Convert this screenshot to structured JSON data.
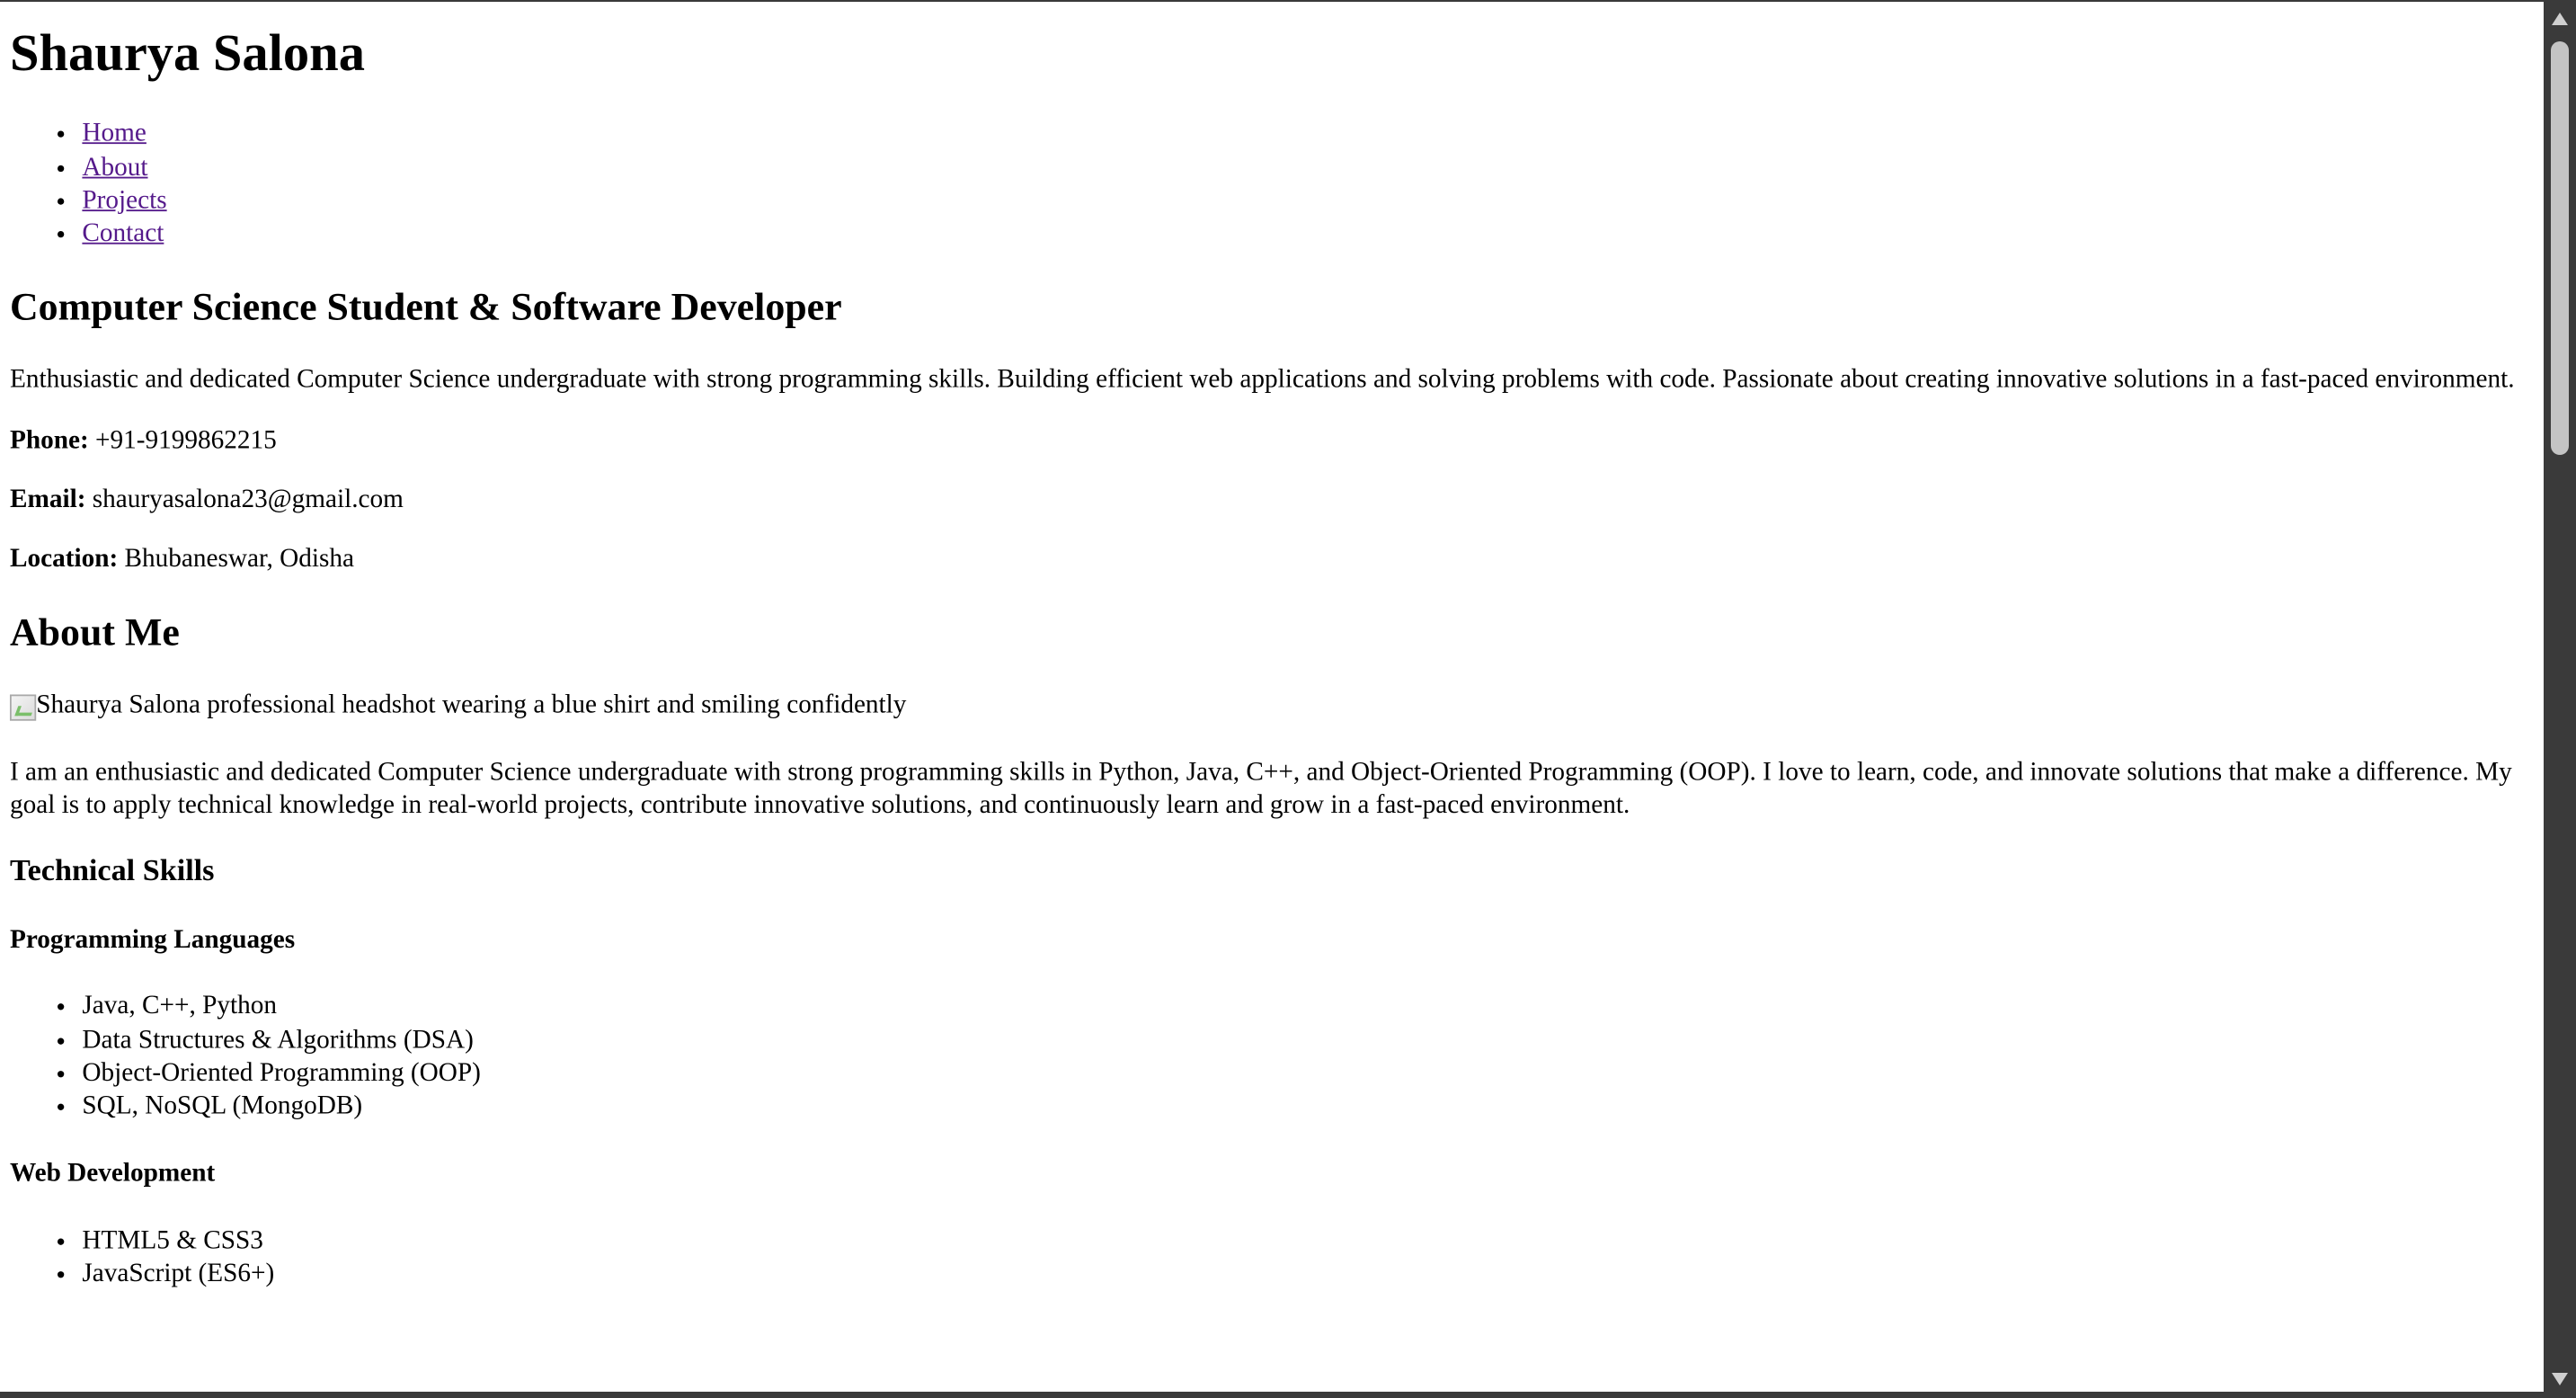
{
  "header": {
    "title": "Shaurya Salona"
  },
  "nav": {
    "items": [
      {
        "label": "Home"
      },
      {
        "label": "About"
      },
      {
        "label": "Projects"
      },
      {
        "label": "Contact"
      }
    ]
  },
  "hero": {
    "heading": "Computer Science Student & Software Developer",
    "intro": "Enthusiastic and dedicated Computer Science undergraduate with strong programming skills. Building efficient web applications and solving problems with code. Passionate about creating innovative solutions in a fast-paced environment.",
    "phone_label": "Phone:",
    "phone_value": " +91-9199862215",
    "email_label": "Email:",
    "email_value": " shauryasalona23@gmail.com",
    "location_label": "Location:",
    "location_value": " Bhubaneswar, Odisha"
  },
  "about": {
    "heading": "About Me",
    "image_alt": "Shaurya Salona professional headshot wearing a blue shirt and smiling confidently",
    "bio": "I am an enthusiastic and dedicated Computer Science undergraduate with strong programming skills in Python, Java, C++, and Object-Oriented Programming (OOP). I love to learn, code, and innovate solutions that make a difference. My goal is to apply technical knowledge in real-world projects, contribute innovative solutions, and continuously learn and grow in a fast-paced environment."
  },
  "skills": {
    "heading": "Technical Skills",
    "groups": [
      {
        "title": "Programming Languages",
        "items": [
          "Java, C++, Python",
          "Data Structures & Algorithms (DSA)",
          "Object-Oriented Programming (OOP)",
          "SQL, NoSQL (MongoDB)"
        ]
      },
      {
        "title": "Web Development",
        "items": [
          "HTML5 & CSS3",
          "JavaScript (ES6+)"
        ]
      }
    ]
  },
  "colors": {
    "link": "#551a8b",
    "scrollbar_track": "#3a3a3a",
    "scrollbar_thumb": "#c4c4c4"
  }
}
